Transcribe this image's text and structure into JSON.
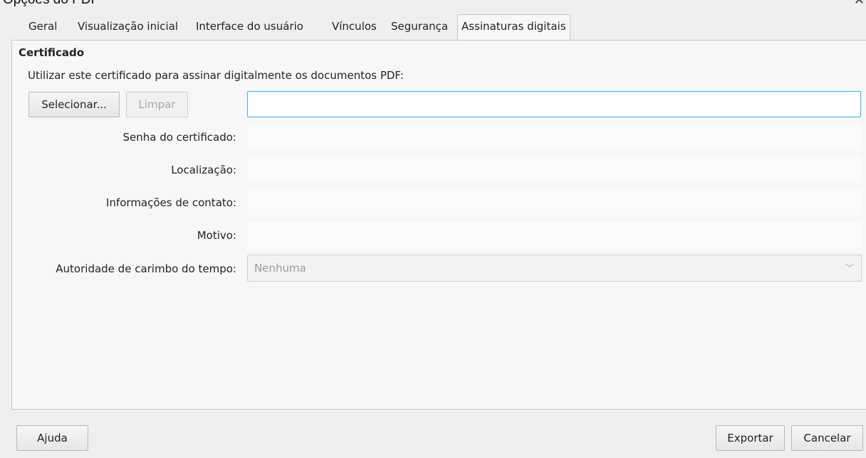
{
  "window": {
    "title": "Opções do PDF",
    "close_glyph": "✕"
  },
  "tabs": [
    {
      "label": "Geral"
    },
    {
      "label": "Visualização inicial"
    },
    {
      "label": "Interface do usuário"
    },
    {
      "label": "Vínculos"
    },
    {
      "label": "Segurança"
    },
    {
      "label": "Assinaturas digitais",
      "active": true
    }
  ],
  "certificate": {
    "heading": "Certificado",
    "description": "Utilizar este certificado para assinar digitalmente os documentos PDF:",
    "select_button": "Selecionar...",
    "clear_button": "Limpar",
    "certificate_value": ""
  },
  "fields": {
    "password_label": "Senha do certificado:",
    "location_label": "Localização:",
    "contact_label": "Informações de contato:",
    "reason_label": "Motivo:",
    "tsa_label": "Autoridade de carimbo do tempo:",
    "tsa_value": "Nenhuma"
  },
  "footer": {
    "help_button": "Ajuda",
    "export_button": "Exportar",
    "cancel_button": "Cancelar"
  },
  "colors": {
    "focus_border": "#3daee9",
    "panel_bg": "#f7f7f7",
    "window_bg": "#efefef"
  }
}
